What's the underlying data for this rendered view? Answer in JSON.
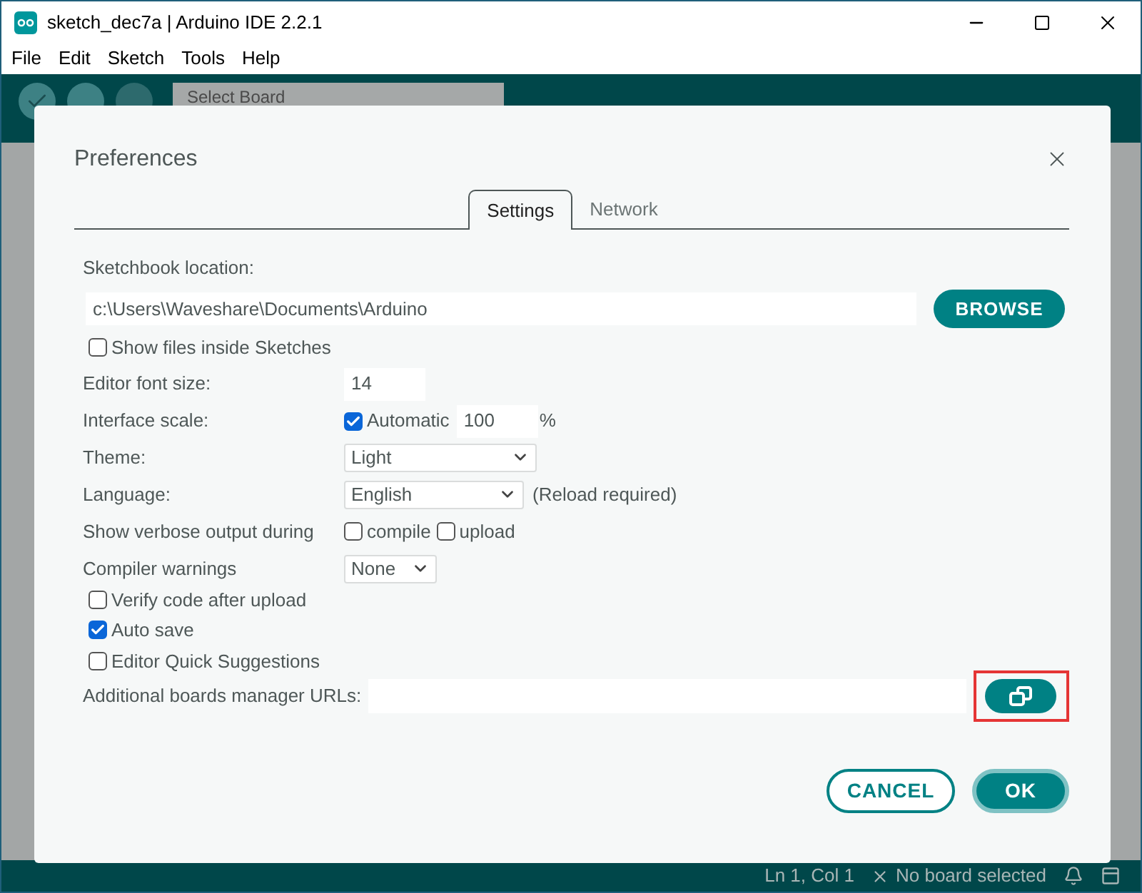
{
  "window": {
    "title": "sketch_dec7a | Arduino IDE 2.2.1"
  },
  "menu": [
    "File",
    "Edit",
    "Sketch",
    "Tools",
    "Help"
  ],
  "toolbar": {
    "board_select": "Select Board"
  },
  "dialog": {
    "title": "Preferences",
    "tabs": [
      {
        "label": "Settings",
        "selected": true
      },
      {
        "label": "Network",
        "selected": false
      }
    ],
    "sketchbook": {
      "label": "Sketchbook location:",
      "value": "c:\\Users\\Waveshare\\Documents\\Arduino",
      "button": "BROWSE"
    },
    "show_files": {
      "label": "Show files inside Sketches",
      "checked": false
    },
    "font_size": {
      "label": "Editor font size:",
      "value": "14"
    },
    "interface_scale": {
      "label": "Interface scale:",
      "automatic": {
        "label": "Automatic",
        "checked": true
      },
      "value": "100",
      "unit": "%"
    },
    "theme": {
      "label": "Theme:",
      "value": "Light"
    },
    "language": {
      "label": "Language:",
      "value": "English",
      "note": "(Reload required)"
    },
    "verbose": {
      "label": "Show verbose output during",
      "options": [
        {
          "label": "compile",
          "checked": false
        },
        {
          "label": "upload",
          "checked": false
        }
      ]
    },
    "compiler_warnings": {
      "label": "Compiler warnings",
      "value": "None"
    },
    "options": [
      {
        "label": "Verify code after upload",
        "checked": false
      },
      {
        "label": "Auto save",
        "checked": true
      },
      {
        "label": "Editor Quick Suggestions",
        "checked": false
      }
    ],
    "boards_urls": {
      "label": "Additional boards manager URLs:",
      "highlighted": true
    },
    "buttons": [
      {
        "label": "CANCEL",
        "kind": "secondary"
      },
      {
        "label": "OK",
        "kind": "primary"
      }
    ]
  },
  "status_bar": {
    "position": "Ln 1, Col 1",
    "board": "No board selected"
  }
}
